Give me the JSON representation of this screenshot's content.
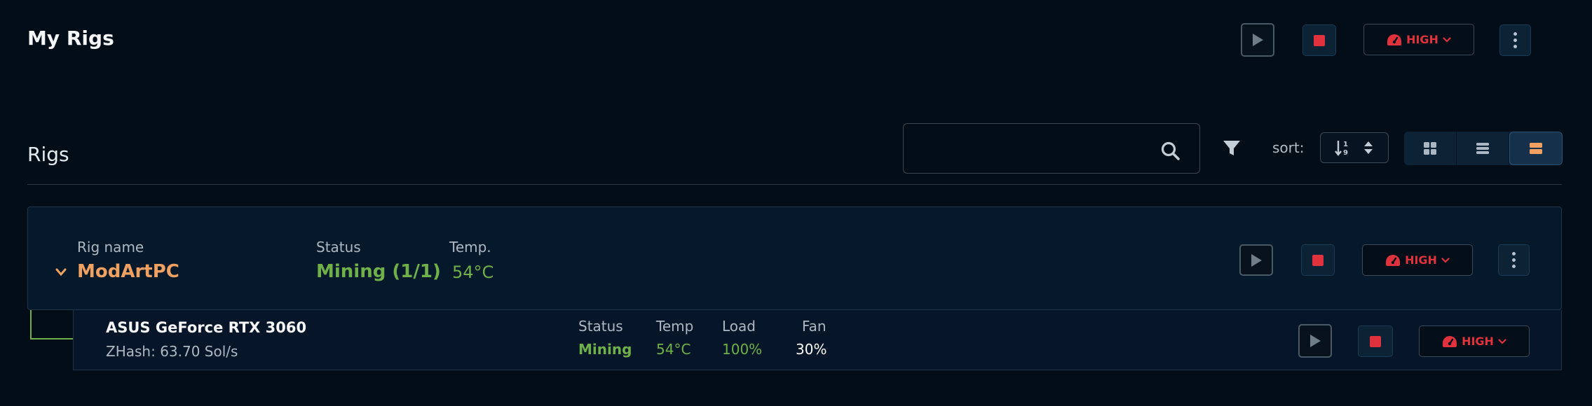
{
  "header": {
    "title": "My Rigs",
    "power_mode": "HIGH"
  },
  "rigs_section": {
    "title": "Rigs",
    "search": {
      "value": "",
      "placeholder": ""
    },
    "sort_label": "sort:",
    "view_modes": [
      "grid",
      "list",
      "detail"
    ],
    "active_view": "detail"
  },
  "rigs": [
    {
      "labels": {
        "name": "Rig name",
        "status": "Status",
        "temp": "Temp."
      },
      "name": "ModArtPC",
      "status": "Mining (1/1)",
      "temp": "54°C",
      "power_mode": "HIGH",
      "devices": [
        {
          "name": "ASUS GeForce RTX 3060",
          "hashrate": "ZHash: 63.70 Sol/s",
          "labels": {
            "status": "Status",
            "temp": "Temp",
            "load": "Load",
            "fan": "Fan"
          },
          "status": "Mining",
          "temp": "54°C",
          "load": "100%",
          "fan": "30%",
          "power_mode": "HIGH"
        }
      ]
    }
  ],
  "colors": {
    "background": "#030d17",
    "accent_orange": "#f0a060",
    "mining_green": "#6fb04a",
    "stop_red": "#e0323c"
  }
}
